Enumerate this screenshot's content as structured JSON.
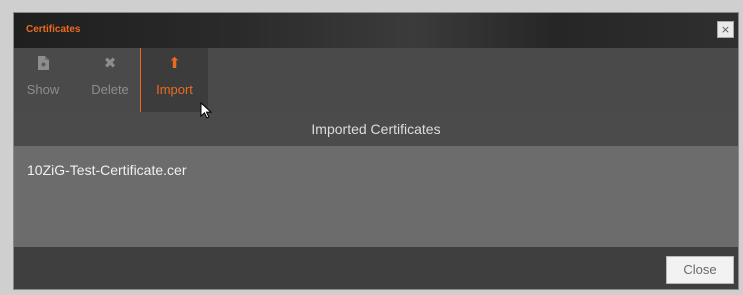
{
  "dialog": {
    "title": "Certificates",
    "close_glyph": "×"
  },
  "toolbar": {
    "show_label": "Show",
    "delete_label": "Delete",
    "import_label": "Import",
    "delete_glyph": "✖",
    "import_glyph": "⬆"
  },
  "list": {
    "header": "Imported Certificates",
    "items": [
      "10ZiG-Test-Certificate.cer"
    ]
  },
  "footer": {
    "close_label": "Close"
  },
  "colors": {
    "accent": "#ec6a1f",
    "panel": "#5b5b5b",
    "list_bg": "#6c6c6c"
  }
}
